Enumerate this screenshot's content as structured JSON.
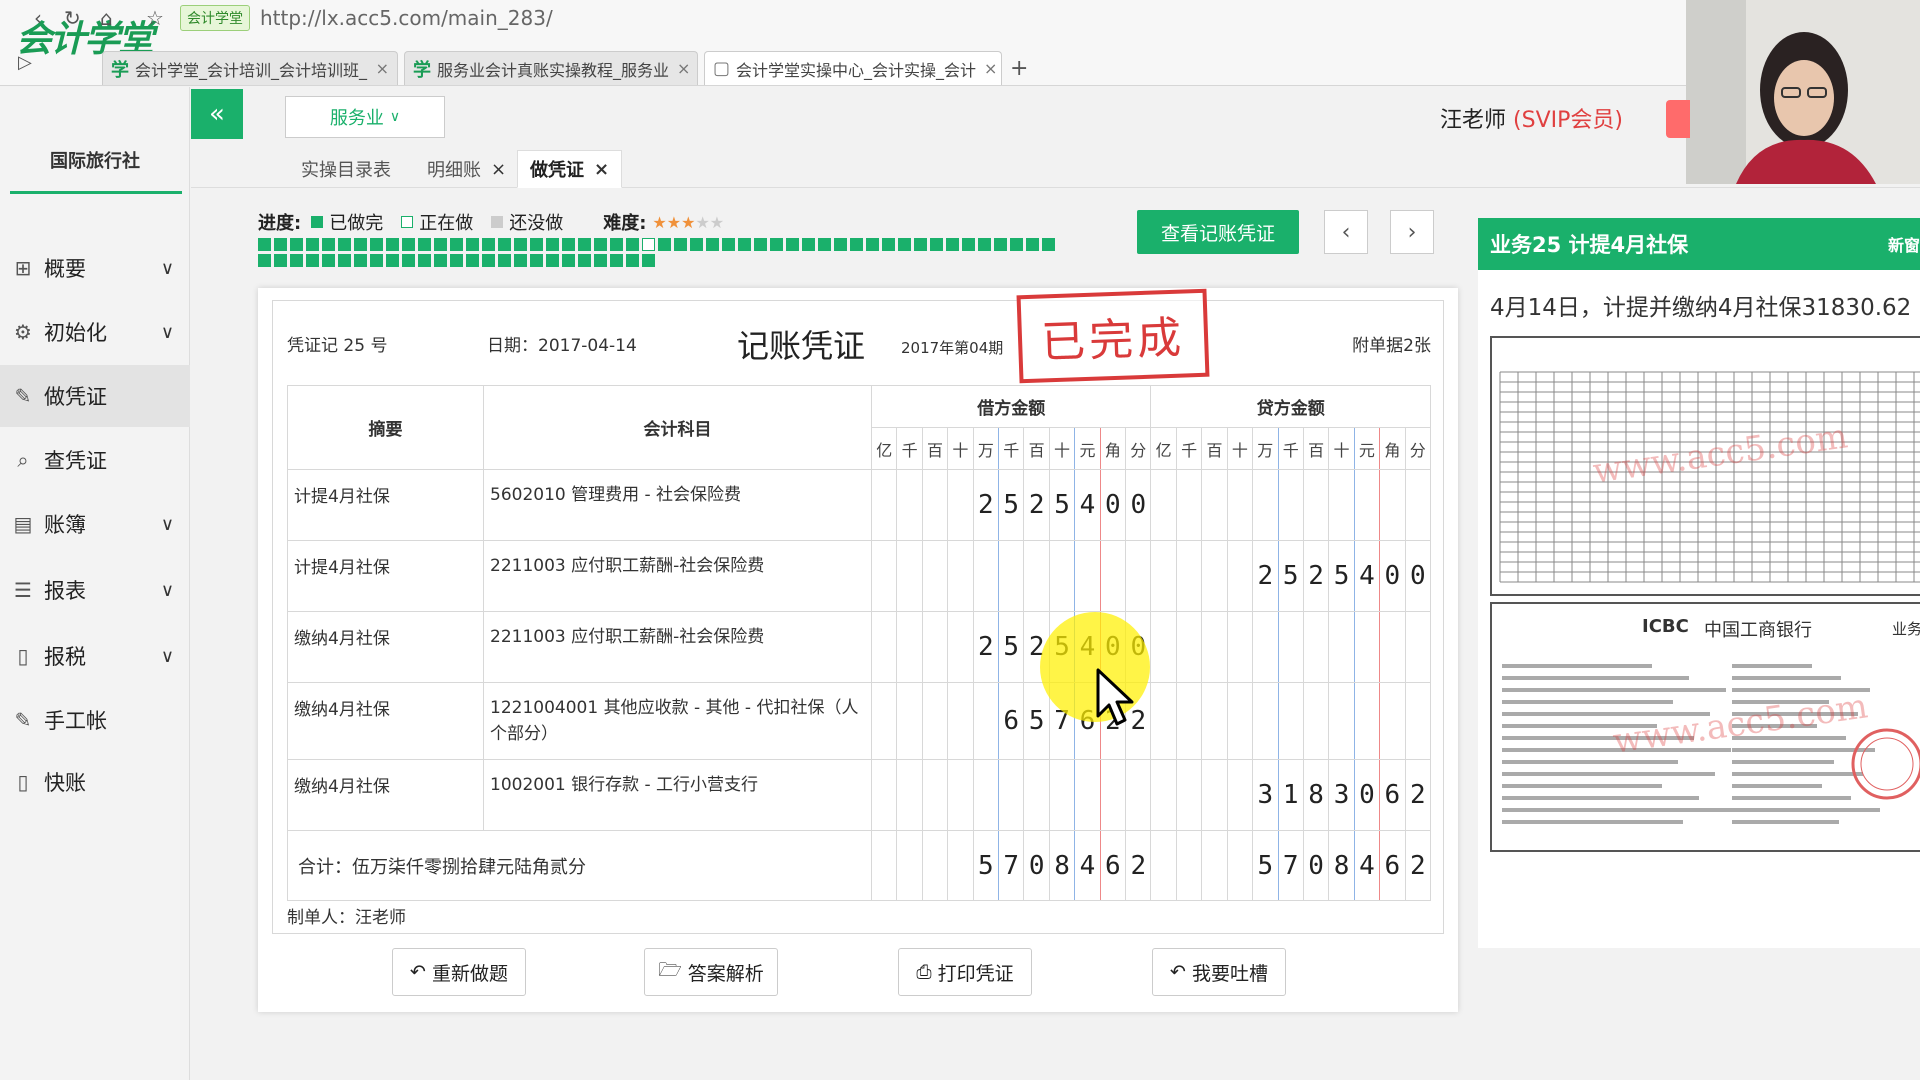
{
  "browser": {
    "logo_text": "会计学堂",
    "site_badge": "会计学堂",
    "url": "http://lx.acc5.com/main_283/",
    "tabs": [
      {
        "label": "会计学堂_会计培训_会计培训班_"
      },
      {
        "label": "服务业会计真账实操教程_服务业"
      },
      {
        "label": "会计学堂实操中心_会计实操_会计"
      }
    ],
    "tab_close": "×",
    "new_tab": "+"
  },
  "sidebar": {
    "company": "国际旅行社",
    "items": [
      {
        "label": "概要",
        "icon": "grid-icon",
        "expandable": true
      },
      {
        "label": "初始化",
        "icon": "gear-icon",
        "expandable": true
      },
      {
        "label": "做凭证",
        "icon": "pen-icon",
        "expandable": false,
        "active": true
      },
      {
        "label": "查凭证",
        "icon": "search-icon",
        "expandable": false
      },
      {
        "label": "账簿",
        "icon": "book-icon",
        "expandable": true
      },
      {
        "label": "报表",
        "icon": "report-icon",
        "expandable": true
      },
      {
        "label": "报税",
        "icon": "file-icon",
        "expandable": true
      },
      {
        "label": "手工帐",
        "icon": "pen-icon",
        "expandable": false
      },
      {
        "label": "快账",
        "icon": "file-icon",
        "expandable": false
      }
    ]
  },
  "topbar": {
    "collapse_icon": "«",
    "industry": "服务业",
    "teacher": "汪老师",
    "teacher_level": "(SVIP会员)"
  },
  "page_tabs": [
    {
      "label": "实操目录表",
      "closable": false
    },
    {
      "label": "明细账",
      "closable": true
    },
    {
      "label": "做凭证",
      "closable": true,
      "active": true
    }
  ],
  "close_glyph": "×",
  "progress": {
    "label": "进度:",
    "done_label": "已做完",
    "doing_label": "正在做",
    "todo_label": "还没做",
    "difficulty_label": "难度:",
    "difficulty_stars": 3,
    "difficulty_max": 5,
    "total_tasks": 75,
    "done_tasks": 24,
    "current_task": 25,
    "colors": {
      "done": "#1ab06b",
      "todo": "#dddddd"
    }
  },
  "actions": {
    "view_voucher": "查看记账凭证",
    "prev": "‹",
    "next": "›"
  },
  "voucher": {
    "number": "凭证记 25 号",
    "date": "日期：2017-04-14",
    "title": "记账凭证",
    "period": "2017年第04期",
    "attachments": "附单据2张",
    "stamp": "已完成",
    "headers": {
      "summary": "摘要",
      "account": "会计科目",
      "debit": "借方金额",
      "credit": "贷方金额"
    },
    "units": [
      "亿",
      "千",
      "百",
      "十",
      "万",
      "千",
      "百",
      "十",
      "元",
      "角",
      "分"
    ],
    "rows": [
      {
        "summary": "计提4月社保",
        "account": "5602010 管理费用 - 社会保险费",
        "debit": "2525400",
        "credit": ""
      },
      {
        "summary": "计提4月社保",
        "account": "2211003 应付职工薪酬-社会保险费",
        "debit": "",
        "credit": "2525400"
      },
      {
        "summary": "缴纳4月社保",
        "account": "2211003 应付职工薪酬-社会保险费",
        "debit": "2525400",
        "credit": ""
      },
      {
        "summary": "缴纳4月社保",
        "account": "1221004001 其他应收款 - 其他 - 代扣社保（人个部分）",
        "debit": "657622",
        "credit": ""
      },
      {
        "summary": "缴纳4月社保",
        "account": "1002001 银行存款 - 工行小营支行",
        "debit": "",
        "credit": "3183062"
      }
    ],
    "total_label": "合计：伍万柒仟零捌拾肆元陆角贰分",
    "total_debit": "5708462",
    "total_credit": "5708462",
    "preparer": "制单人：汪老师"
  },
  "buttons": {
    "redo": "重新做题",
    "answer": "答案解析",
    "print": "打印凭证",
    "feedback": "我要吐槽"
  },
  "right_panel": {
    "title": "业务25 计提4月社保",
    "new_window": "新窗",
    "description": "4月14日，计提并缴纳4月社保31830.62",
    "watermark": "www.acc5.com",
    "bank_en": "ICBC",
    "bank_cn": "中国工商银行",
    "bank_biz": "业务"
  }
}
